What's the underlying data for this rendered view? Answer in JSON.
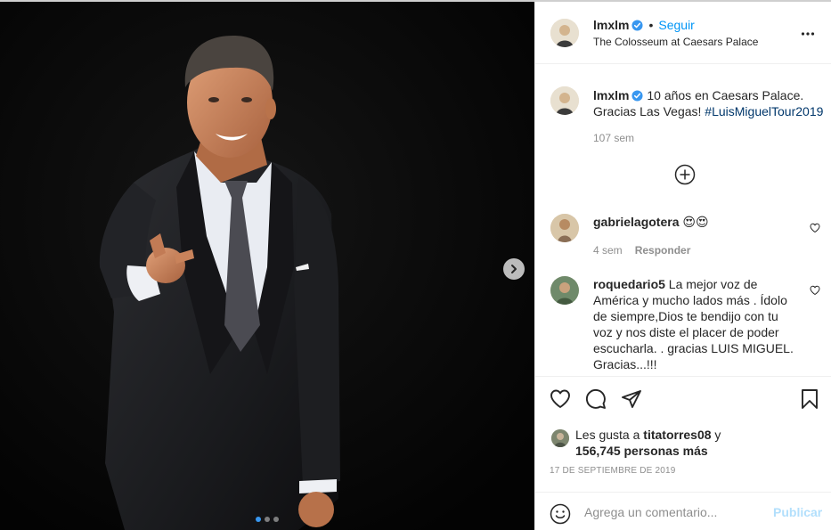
{
  "post": {
    "username": "lmxlm",
    "follow_label": "Seguir",
    "separator": "•",
    "location": "The Colosseum at Caesars Palace",
    "caption": "10 años en Caesars Palace. Gracias Las Vegas! ",
    "hashtag": "#LuisMiguelTour2019",
    "caption_time": "107 sem",
    "carousel": {
      "slides": 3,
      "active_slide": 1
    }
  },
  "comments": [
    {
      "username": "gabrielagotera",
      "text": "😍😍",
      "time": "4 sem",
      "reply_label": "Responder"
    },
    {
      "username": "roquedario5",
      "text": "La mejor voz de América y mucho lados más . Ídolo de siempre,Dios te bendijo con tu voz y nos diste el placer de poder escucharla. . gracias LUIS MIGUEL. Gracias...!!!"
    }
  ],
  "likes": {
    "prefix": "Les gusta a ",
    "first_user": "titatorres08",
    "connector": " y",
    "others": "156,745 personas más"
  },
  "date": "17 DE SEPTIEMBRE DE 2019",
  "add_comment": {
    "placeholder": "Agrega un comentario...",
    "publish_label": "Publicar"
  },
  "colors": {
    "accent": "#0095f6",
    "hashtag": "#00376b",
    "muted": "#8e8e8e",
    "border": "#efefef",
    "publish_disabled": "#b2dffc",
    "carousel_active": "#3897f0"
  },
  "icons": {
    "more": "more-options-icon",
    "heart": "heart-icon",
    "comment": "comment-icon",
    "share": "share-icon",
    "save": "bookmark-icon",
    "emoji": "emoji-icon",
    "next": "chevron-right-icon",
    "load_more": "plus-circle-icon",
    "verified": "verified-badge-icon"
  }
}
